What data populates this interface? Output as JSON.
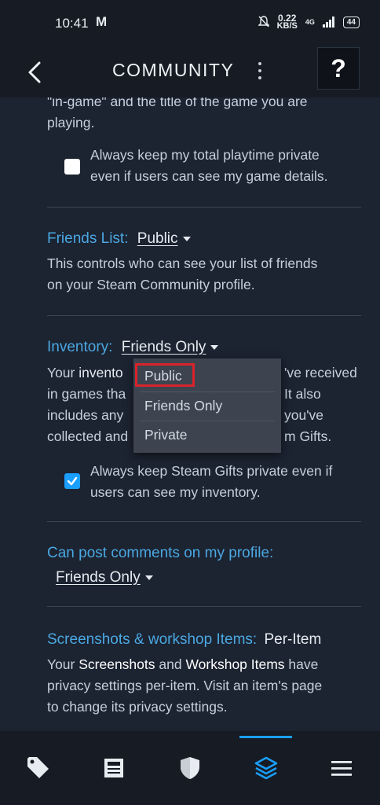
{
  "status_bar": {
    "time": "10:41",
    "gmail_icon": "M",
    "speed_value": "0.22",
    "speed_unit": "KB/S",
    "network": "4G",
    "battery": "44"
  },
  "header": {
    "title": "COMMUNITY",
    "help_label": "?"
  },
  "content": {
    "top_text_line1": "\"in-game\" and the title of the game you are",
    "top_text_line2": "playing.",
    "playtime_check_line1": "Always keep my total playtime private",
    "playtime_check_line2": "even if users can see my game details.",
    "friends_list_label": "Friends List:",
    "friends_list_value": "Public",
    "friends_list_desc_line1": "This controls who can see your list of friends",
    "friends_list_desc_line2": "on your Steam Community profile.",
    "inventory_label": "Inventory:",
    "inventory_value": "Friends Only",
    "inventory_desc_line1_a": "Your",
    "inventory_desc_line1_b": "invento",
    "inventory_desc_line1_c": "'ve received",
    "inventory_desc_line2_a": "in games tha",
    "inventory_desc_line2_b": "It also",
    "inventory_desc_line3_a": "includes any",
    "inventory_desc_line3_b": "you've",
    "inventory_desc_line4_a": "collected and",
    "inventory_desc_line4_b": "m Gifts.",
    "gifts_check_line1": "Always keep Steam Gifts private even if",
    "gifts_check_line2": "users can see my inventory.",
    "comments_label": "Can post comments on my profile:",
    "comments_value": "Friends Only",
    "screenshots_label": "Screenshots & workshop Items:",
    "screenshots_value": "Per-Item",
    "screenshots_desc_line1_a": "Your ",
    "screenshots_desc_line1_b": "Screenshots",
    "screenshots_desc_line1_c": " and ",
    "screenshots_desc_line1_d": "Workshop Items",
    "screenshots_desc_line1_e": " have",
    "screenshots_desc_line2": "privacy settings per-item. Visit an item's page",
    "screenshots_desc_line3": "to change its privacy settings."
  },
  "dropdown_menu": {
    "options": [
      "Public",
      "Friends Only",
      "Private"
    ],
    "highlighted": "Public"
  },
  "bottom_nav": {
    "items": [
      "tag-icon",
      "news-icon",
      "shield-icon",
      "layers-icon",
      "menu-icon"
    ],
    "active": "layers-icon"
  },
  "colors": {
    "background": "#1c2331",
    "accent_blue": "#1a9fff",
    "label_blue": "#4aa8e2",
    "highlight_red": "#d9232b"
  }
}
